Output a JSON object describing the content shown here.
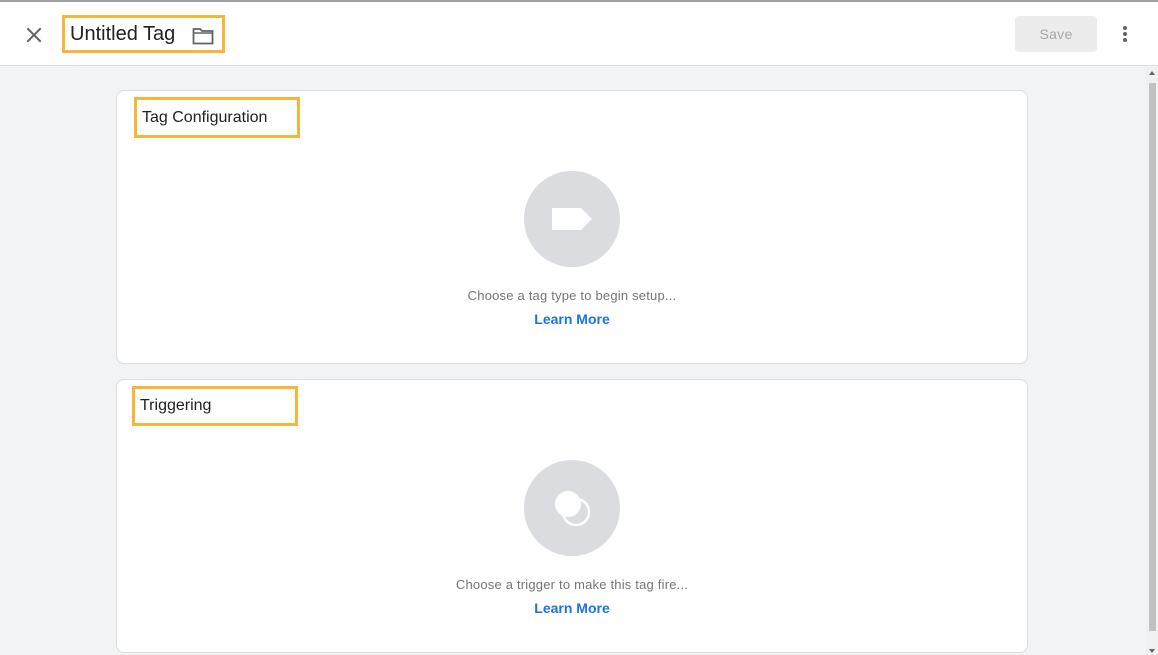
{
  "header": {
    "title": "Untitled Tag",
    "save_label": "Save"
  },
  "tag_config": {
    "title": "Tag Configuration",
    "hint": "Choose a tag type to begin setup...",
    "learn_more": "Learn More"
  },
  "triggering": {
    "title": "Triggering",
    "hint": "Choose a trigger to make this tag fire...",
    "learn_more": "Learn More"
  },
  "icons": {
    "close": "close-icon",
    "folder": "folder-icon",
    "more": "more-vert-icon",
    "tag": "tag-icon",
    "trigger": "trigger-icon"
  },
  "colors": {
    "highlight": "#f9b43a",
    "link": "#1a73e8",
    "placeholder_circle": "#dadce0",
    "background": "#f1f3f4"
  }
}
